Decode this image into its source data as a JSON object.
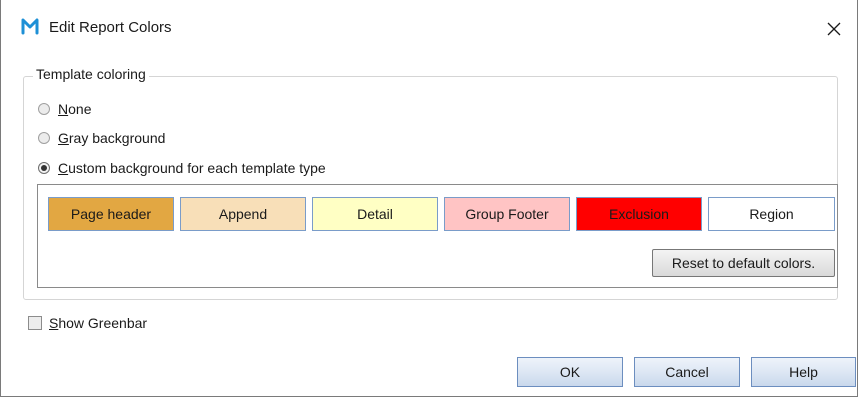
{
  "window": {
    "title": "Edit Report Colors",
    "app_icon": "m-logo-icon",
    "close_glyph": "✕"
  },
  "template_coloring": {
    "legend": "Template coloring",
    "options": [
      {
        "mnemonic": "N",
        "rest": "one",
        "checked": false
      },
      {
        "mnemonic": "G",
        "rest": "ray background",
        "checked": false
      },
      {
        "mnemonic": "C",
        "rest": "ustom background for each template type",
        "checked": true
      }
    ],
    "template_types": [
      {
        "label": "Page header",
        "color": "#E2A742"
      },
      {
        "label": "Append",
        "color": "#F8DFB8"
      },
      {
        "label": "Detail",
        "color": "#FFFFC4"
      },
      {
        "label": "Group Footer",
        "color": "#FFC4C4"
      },
      {
        "label": "Exclusion",
        "color": "#FF0000"
      },
      {
        "label": "Region",
        "color": "#FFFFFF"
      }
    ],
    "reset_label": "Reset to default colors."
  },
  "greenbar": {
    "mnemonic": "S",
    "rest": "how Greenbar",
    "checked": false
  },
  "footer": {
    "ok_label": "OK",
    "cancel_label": "Cancel",
    "help_label": "Help"
  },
  "colors": {
    "accent": "#6C8EBF",
    "logo": "#1E90D6"
  }
}
